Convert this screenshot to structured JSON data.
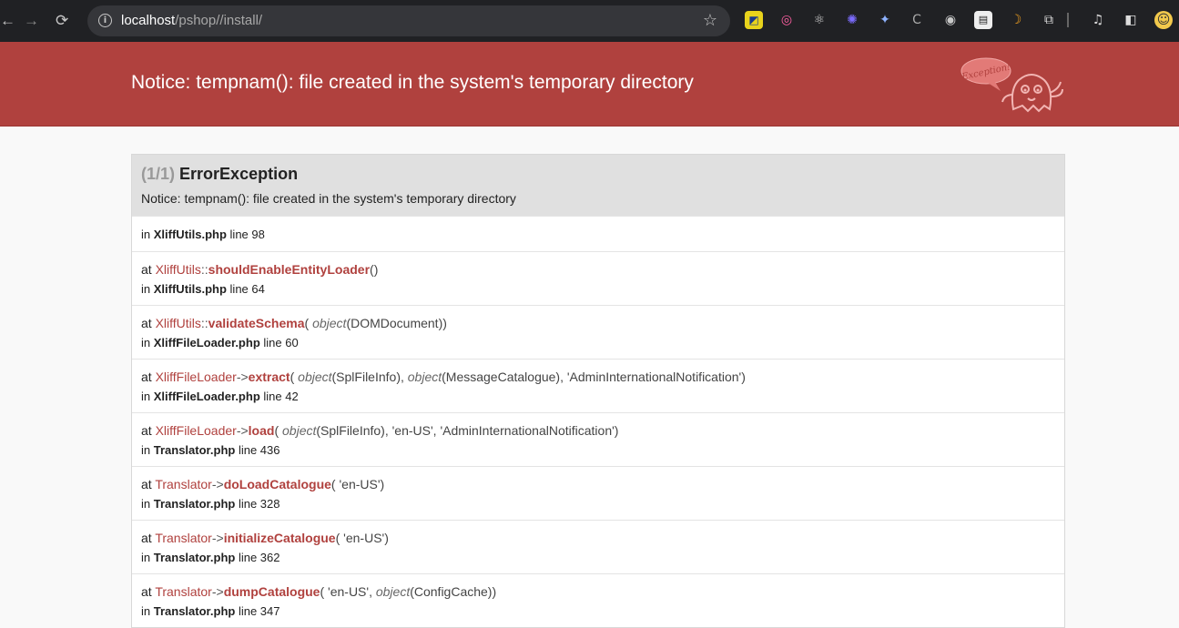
{
  "browser": {
    "url_host": "localhost",
    "url_path": "/pshop//install/"
  },
  "header": {
    "title": "Notice: tempnam(): file created in the system's temporary directory",
    "logo_text": "Exception!"
  },
  "exception": {
    "count": "(1/1)",
    "type": "ErrorException",
    "message": "Notice: tempnam(): file created in the system's temporary directory",
    "first_location": {
      "file": "XliffUtils.php",
      "line": "line 98"
    },
    "trace": [
      {
        "class": "XliffUtils",
        "sep": "::",
        "method": "shouldEnableEntityLoader",
        "args": [],
        "file": "XliffUtils.php",
        "line": "line 64"
      },
      {
        "class": "XliffUtils",
        "sep": "::",
        "method": "validateSchema",
        "args": [
          {
            "obj": "object",
            "val": "(DOMDocument)"
          }
        ],
        "file": "XliffFileLoader.php",
        "line": "line 60"
      },
      {
        "class": "XliffFileLoader",
        "sep": "->",
        "method": "extract",
        "args": [
          {
            "obj": "object",
            "val": "(SplFileInfo)"
          },
          {
            "obj": "object",
            "val": "(MessageCatalogue)"
          },
          {
            "val": "'AdminInternationalNotification'"
          }
        ],
        "file": "XliffFileLoader.php",
        "line": "line 42"
      },
      {
        "class": "XliffFileLoader",
        "sep": "->",
        "method": "load",
        "args": [
          {
            "obj": "object",
            "val": "(SplFileInfo)"
          },
          {
            "val": "'en-US'"
          },
          {
            "val": "'AdminInternationalNotification'"
          }
        ],
        "file": "Translator.php",
        "line": "line 436"
      },
      {
        "class": "Translator",
        "sep": "->",
        "method": "doLoadCatalogue",
        "args": [
          {
            "val": "'en-US'"
          }
        ],
        "file": "Translator.php",
        "line": "line 328"
      },
      {
        "class": "Translator",
        "sep": "->",
        "method": "initializeCatalogue",
        "args": [
          {
            "val": "'en-US'"
          }
        ],
        "file": "Translator.php",
        "line": "line 362"
      },
      {
        "class": "Translator",
        "sep": "->",
        "method": "dumpCatalogue",
        "args": [
          {
            "val": "'en-US'"
          },
          {
            "obj": "object",
            "val": "(ConfigCache)"
          }
        ],
        "file": "Translator.php",
        "line": "line 347"
      }
    ]
  },
  "labels": {
    "at": "at",
    "in": "in"
  },
  "colors": {
    "header_bg": "#b0413e",
    "accent": "#b0413e"
  }
}
